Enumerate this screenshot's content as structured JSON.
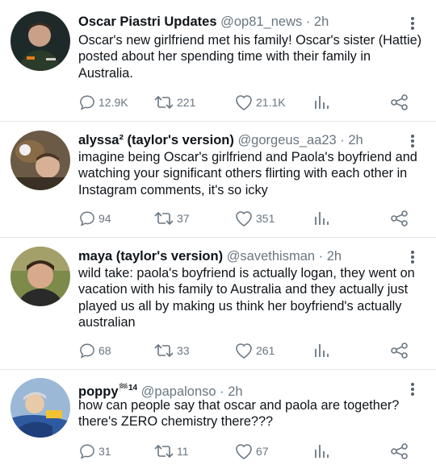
{
  "tweets": [
    {
      "name": "Oscar Piastri Updates",
      "name_sup": "",
      "handle": "@op81_news",
      "time": "2h",
      "text": "Oscar's new girlfriend met his family! Oscar's sister (Hattie) posted about her spending time with their family in Australia.",
      "replies": "12.9K",
      "retweets": "221",
      "likes": "21.1K"
    },
    {
      "name": "alyssa² (taylor's version)",
      "name_sup": "",
      "handle": "@gorgeus_aa23",
      "time": "2h",
      "text": "imagine being Oscar's girlfriend and Paola's boyfriend and watching your significant others flirting with each other in Instagram comments, it's so icky",
      "replies": "94",
      "retweets": "37",
      "likes": "351"
    },
    {
      "name": "maya (taylor's version)",
      "name_sup": "",
      "handle": "@savethisman",
      "time": "2h",
      "text": "wild take: paola's boyfriend is actually logan, they went on vacation with his family to Australia and they actually just played us all by making us think her boyfriend's actually australian",
      "replies": "68",
      "retweets": "33",
      "likes": "261"
    },
    {
      "name": "poppy",
      "name_sup": "🏁14",
      "handle": "@papalonso",
      "time": "2h",
      "text": "how can people say that oscar and paola are together? there's ZERO chemistry there???",
      "replies": "31",
      "retweets": "11",
      "likes": "67"
    }
  ],
  "icons": {
    "reply": "reply-icon",
    "retweet": "retweet-icon",
    "like": "like-icon",
    "views": "views-icon",
    "share": "share-icon",
    "more": "more-icon"
  },
  "colors": {
    "text": "#0f1419",
    "muted": "#6a7681",
    "divider": "#e3e6e8"
  }
}
